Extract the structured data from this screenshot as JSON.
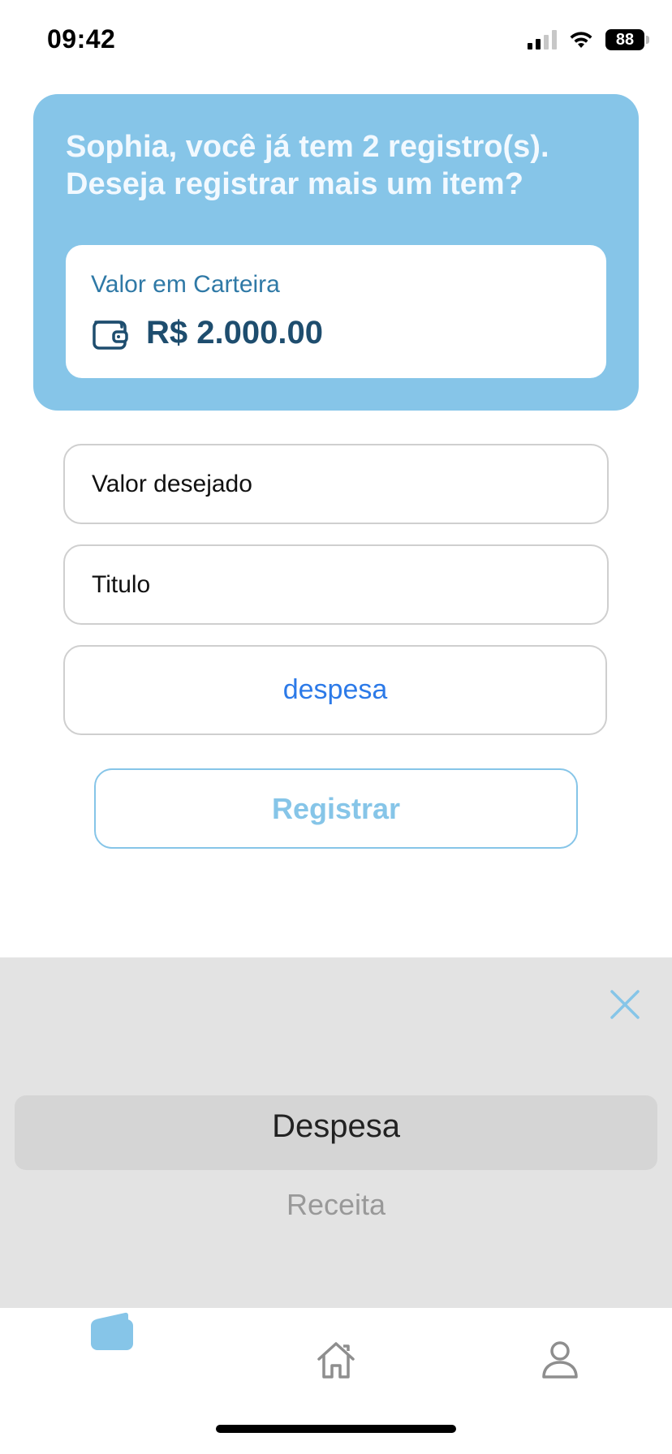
{
  "status_bar": {
    "time": "09:42",
    "battery": "88"
  },
  "hero": {
    "title": "Sophia, você já tem 2 registro(s). Deseja registrar mais um item?",
    "wallet_label": "Valor em Carteira",
    "wallet_value": "R$ 2.000.00",
    "wallet_icon": "wallet-icon"
  },
  "form": {
    "value_placeholder": "Valor desejado",
    "title_placeholder": "Titulo",
    "type_selected": "despesa",
    "register_label": "Registrar"
  },
  "picker": {
    "close_icon": "close-icon",
    "options": [
      "Despesa",
      "Receita"
    ],
    "selected_index": 0
  },
  "tabbar": {
    "items": [
      {
        "icon": "wallet-icon",
        "active": true
      },
      {
        "icon": "home-icon",
        "active": false
      },
      {
        "icon": "profile-icon",
        "active": false
      }
    ]
  },
  "colors": {
    "accent": "#86c5e8",
    "accent_text": "#2f79a6",
    "wallet_value": "#1e4d6e",
    "link_blue": "#2c7ae8",
    "picker_bg": "#e3e3e3"
  }
}
